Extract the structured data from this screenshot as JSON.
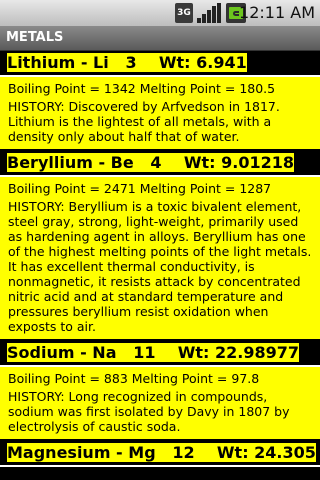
{
  "status_bar": {
    "network_label": "3G",
    "time": "12:11 AM",
    "icons": [
      "3g-icon",
      "signal-icon",
      "battery-icon"
    ]
  },
  "title_bar": {
    "title": "METALS"
  },
  "colors": {
    "accent": "#ffff00",
    "background": "#000000",
    "text": "#000000"
  },
  "items": [
    {
      "title": "Lithium - Li   3    Wt: 6.941",
      "props": "Boiling Point = 1342 Melting Point = 180.5",
      "history": "HISTORY: Discovered by Arfvedson in 1817. Lithium is the lightest of all metals, with a density only about half that of water."
    },
    {
      "title": "Beryllium - Be   4    Wt: 9.01218",
      "props": "Boiling Point = 2471 Melting Point = 1287",
      "history": "HISTORY: Beryllium is a toxic bivalent element, steel gray, strong, light-weight, primarily used as hardening agent in alloys. Beryllium has one of the highest melting points of the light metals. It has excellent thermal conductivity, is nonmagnetic, it resists attack by concentrated nitric acid and at standard temperature and pressures beryllium resist oxidation when exposts to air."
    },
    {
      "title": "Sodium - Na   11    Wt: 22.98977",
      "props": "Boiling Point = 883 Melting Point = 97.8",
      "history": "HISTORY: Long recognized in compounds, sodium was first isolated by Davy in 1807 by electrolysis of caustic soda."
    },
    {
      "title": "Magnesium - Mg   12    Wt: 24.305",
      "props": "",
      "history": ""
    }
  ]
}
